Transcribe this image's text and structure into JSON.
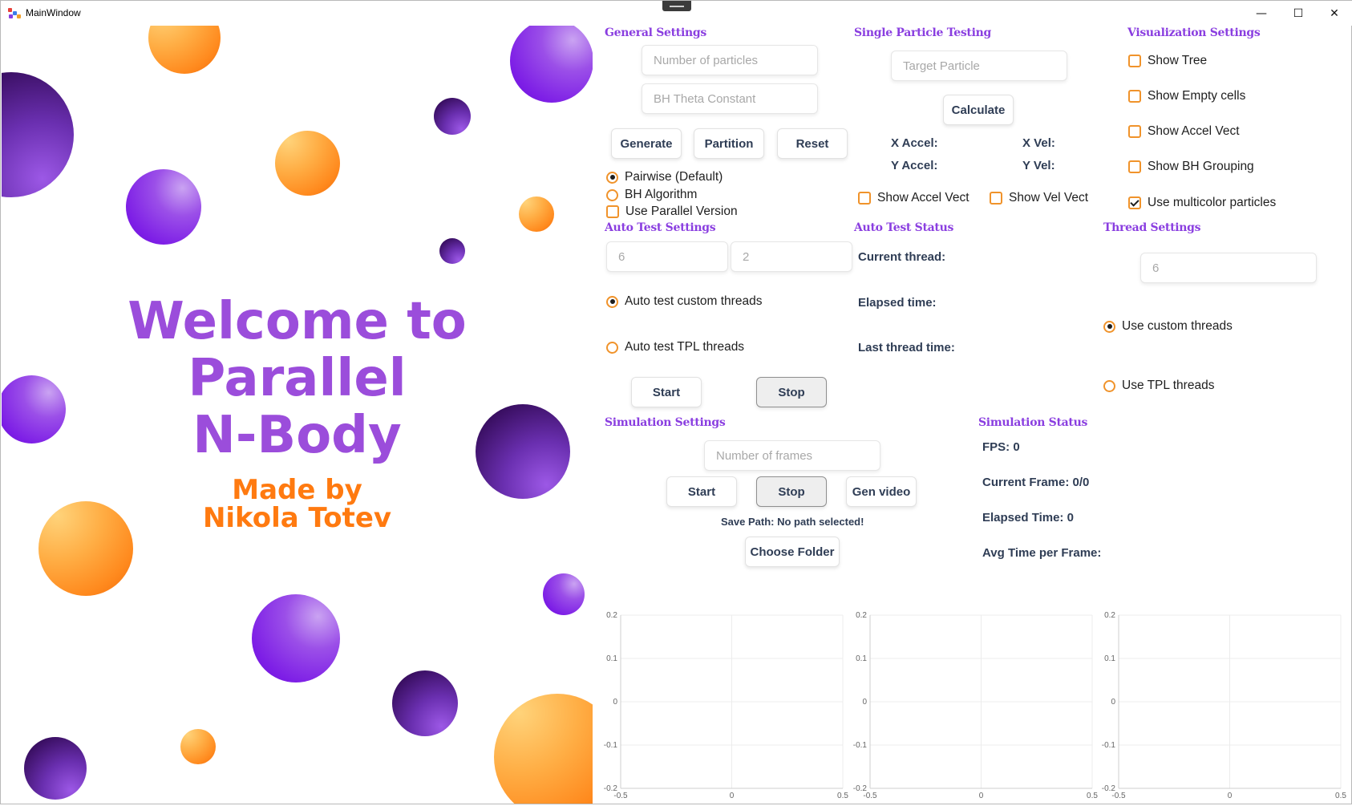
{
  "window": {
    "title": "MainWindow"
  },
  "window_controls": {
    "minimize": "—",
    "maximize": "☐",
    "close": "✕"
  },
  "splash": {
    "welcome_line1": "Welcome to",
    "welcome_line2": "Parallel",
    "welcome_line3": "N-Body",
    "made_line1": "Made by",
    "made_line2": "Nikola Totev"
  },
  "general_settings": {
    "title": "General Settings",
    "particles_placeholder": "Number of particles",
    "theta_placeholder": "BH Theta Constant",
    "generate_label": "Generate",
    "partition_label": "Partition",
    "reset_label": "Reset",
    "pairwise_label": "Pairwise (Default)",
    "pairwise_selected": true,
    "bh_label": "BH Algorithm",
    "bh_selected": false,
    "parallel_label": "Use Parallel Version",
    "parallel_checked": false
  },
  "single_particle": {
    "title": "Single Particle Testing",
    "target_placeholder": "Target Particle",
    "calculate_label": "Calculate",
    "x_accel_label": "X Accel:",
    "y_accel_label": "Y Accel:",
    "x_vel_label": "X Vel:",
    "y_vel_label": "Y Vel:",
    "show_accel_label": "Show Accel Vect",
    "show_vel_label": "Show Vel Vect"
  },
  "visualization": {
    "title": "Visualization Settings",
    "items": [
      {
        "label": "Show Tree",
        "checked": false
      },
      {
        "label": "Show Empty cells",
        "checked": false
      },
      {
        "label": "Show Accel Vect",
        "checked": false
      },
      {
        "label": "Show BH Grouping",
        "checked": false
      },
      {
        "label": "Use multicolor particles",
        "checked": true
      }
    ]
  },
  "auto_test": {
    "title": "Auto Test Settings",
    "input1_placeholder": "6",
    "input2_placeholder": "2",
    "custom_label": "Auto test custom threads",
    "custom_selected": true,
    "tpl_label": "Auto test TPL threads",
    "tpl_selected": false,
    "start_label": "Start",
    "stop_label": "Stop"
  },
  "auto_test_status": {
    "title": "Auto Test Status",
    "current_thread": "Current thread:",
    "elapsed": "Elapsed time:",
    "last_thread": "Last thread time:"
  },
  "thread_settings": {
    "title": "Thread Settings",
    "threads_placeholder": "6",
    "custom_label": "Use custom threads",
    "custom_selected": true,
    "tpl_label": "Use TPL threads",
    "tpl_selected": false
  },
  "simulation_settings": {
    "title": "Simulation Settings",
    "frames_placeholder": "Number of frames",
    "start_label": "Start",
    "stop_label": "Stop",
    "gen_video_label": "Gen video",
    "save_path": "Save Path: No path selected!",
    "choose_folder_label": "Choose Folder"
  },
  "simulation_status": {
    "title": "Simulation Status",
    "fps": "FPS: 0",
    "current_frame": "Current Frame: 0/0",
    "elapsed": "Elapsed Time: 0",
    "avg_time": "Avg Time per Frame:"
  },
  "plots": {
    "y_ticks": [
      "0.2",
      "0.1",
      "0",
      "-0.1",
      "-0.2"
    ],
    "x_ticks": [
      "-0.5",
      "0",
      "0.5"
    ],
    "colors": {
      "grid": "#ececec",
      "axis": "#cfcfcf"
    }
  },
  "colors": {
    "section_title": "#8a3ee0",
    "accent_orange": "#f0932b",
    "button_text": "#2f3d55",
    "welcome_purple": "#9b4ddb",
    "made_orange": "#ff7a10"
  }
}
